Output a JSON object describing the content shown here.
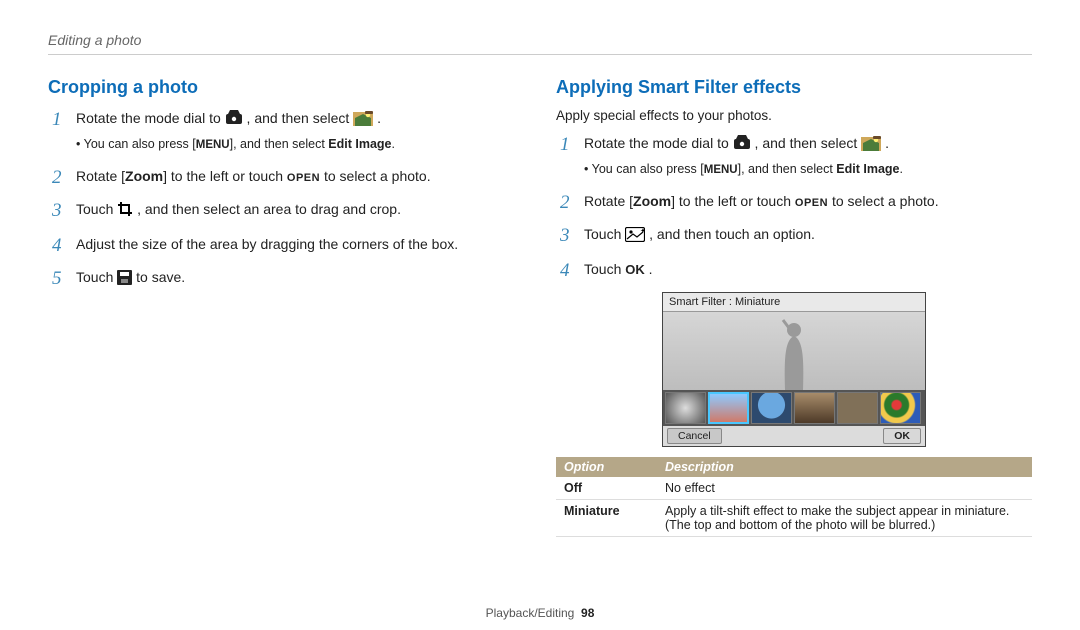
{
  "breadcrumb": "Editing a photo",
  "footer": {
    "section": "Playback/Editing",
    "page": "98"
  },
  "left": {
    "title": "Cropping a photo",
    "steps": {
      "s1_a": "Rotate the mode dial to ",
      "s1_b": ", and then select ",
      "s1_c": ".",
      "s1_note_a": "You can also press [",
      "s1_note_b": "], and then select ",
      "s1_note_c": "Edit Image",
      "s1_note_d": ".",
      "s2_a": "Rotate [",
      "s2_zoom": "Zoom",
      "s2_b": "] to the left or touch ",
      "s2_open": "OPEN",
      "s2_c": " to select a photo.",
      "s3_a": "Touch ",
      "s3_b": ", and then select an area to drag and crop.",
      "s4": "Adjust the size of the area by dragging the corners of the box.",
      "s5_a": "Touch ",
      "s5_b": " to save."
    }
  },
  "right": {
    "title": "Applying Smart Filter effects",
    "intro": "Apply special effects to your photos.",
    "steps": {
      "s1_a": "Rotate the mode dial to ",
      "s1_b": ", and then select ",
      "s1_c": ".",
      "s1_note_a": "You can also press [",
      "s1_note_b": "], and then select ",
      "s1_note_c": "Edit Image",
      "s1_note_d": ".",
      "s2_a": "Rotate [",
      "s2_zoom": "Zoom",
      "s2_b": "] to the left or touch ",
      "s2_open": "OPEN",
      "s2_c": " to select a photo.",
      "s3_a": "Touch ",
      "s3_b": ", and then touch an option.",
      "s4_a": "Touch ",
      "s4_b": "."
    },
    "screen": {
      "title": "Smart Filter : Miniature",
      "cancel": "Cancel",
      "ok": "OK"
    },
    "table": {
      "h1": "Option",
      "h2": "Description",
      "rows": [
        {
          "opt": "Off",
          "desc": "No effect"
        },
        {
          "opt": "Miniature",
          "desc": "Apply a tilt-shift effect to make the subject appear in miniature. (The top and bottom of the photo will be blurred.)"
        }
      ]
    }
  },
  "labels": {
    "menu": "MENU",
    "ok": "OK"
  }
}
